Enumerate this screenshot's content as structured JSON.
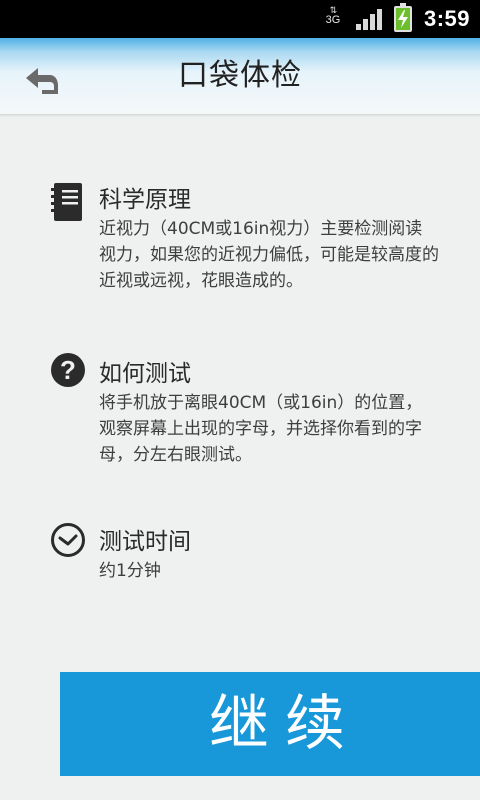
{
  "status_bar": {
    "network_label": "3G",
    "time": "3:59"
  },
  "header": {
    "title": "口袋体检",
    "back_icon": "back-arrow-icon"
  },
  "sections": [
    {
      "icon": "notebook-icon",
      "title": "科学原理",
      "body": "近视力（40CM或16in视力）主要检测阅读视力，如果您的近视力偏低，可能是较高度的近视或远视，花眼造成的。"
    },
    {
      "icon": "question-icon",
      "title": "如何测试",
      "body": "将手机放于离眼40CM（或16in）的位置，观察屏幕上出现的字母，并选择你看到的字母，分左右眼测试。"
    },
    {
      "icon": "clock-icon",
      "title": "测试时间",
      "body": "约1分钟"
    }
  ],
  "continue_button": {
    "label": "继续",
    "color": "#1897d9"
  }
}
